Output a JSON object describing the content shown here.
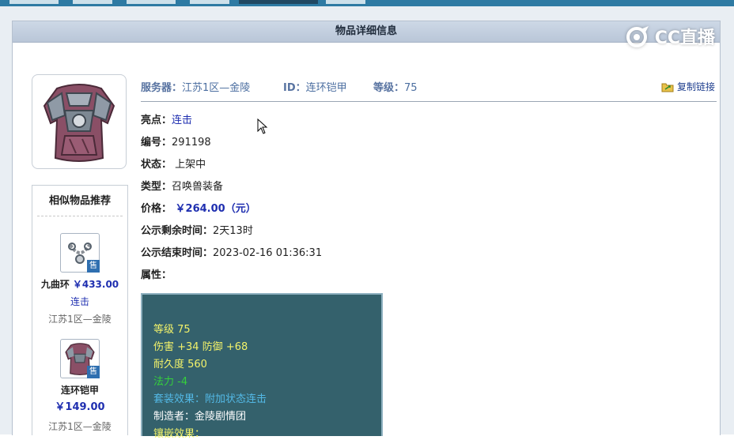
{
  "panel_title": "物品详细信息",
  "watermark": "CC直播",
  "info": {
    "server_label": "服务器：",
    "server_value": "江苏1区—金陵",
    "id_label": "ID：",
    "id_value": "连环铠甲",
    "level_label": "等级：",
    "level_value": "75",
    "copy_link": "复制链接"
  },
  "details": [
    {
      "key": "亮点：",
      "value": "连击"
    },
    {
      "key": "编号：",
      "value": "291198"
    },
    {
      "key": "状态：",
      "value": " 上架中"
    },
    {
      "key": "类型：",
      "value": "召唤兽装备"
    },
    {
      "key": "价格：",
      "value": " ￥264.00（元）"
    },
    {
      "key": "公示剩余时间：",
      "value": "2天13时"
    },
    {
      "key": "公示结束时间：",
      "value": "2023-02-16 01:36:31"
    },
    {
      "key": "属性：",
      "value": ""
    }
  ],
  "attributes": [
    {
      "text": "等级 75",
      "color": "#f2f26a"
    },
    {
      "text": "伤害 +34 防御 +68",
      "color": "#f2f26a"
    },
    {
      "text": "耐久度 560",
      "color": "#f2f26a"
    },
    {
      "text": "法力 -4",
      "color": "#35d13b"
    },
    {
      "text": "套装效果：附加状态连击",
      "color": "#53b9e6"
    },
    {
      "text": "制造者：金陵剧情团",
      "color": "#ffffff"
    },
    {
      "text": "镶嵌效果：",
      "color": "#f2f26a"
    }
  ],
  "similar": {
    "title": "相似物品推荐",
    "sale_badge": "售",
    "items": [
      {
        "name": "九曲环",
        "price": "￥433.00",
        "highlight": "连击",
        "server": "江苏1区—金陵"
      },
      {
        "name": "连环铠甲",
        "price": "￥149.00",
        "highlight": "",
        "server": "江苏1区—金陵"
      }
    ]
  }
}
